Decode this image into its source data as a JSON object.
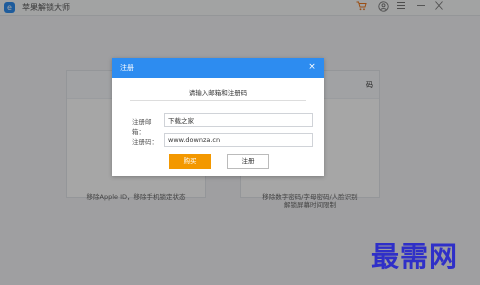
{
  "window": {
    "title": "苹果解锁大师",
    "icons": [
      "app-logo-icon",
      "cart-icon",
      "user-icon",
      "menu-icon",
      "minimize-icon",
      "close-icon"
    ]
  },
  "cards": {
    "left": {
      "desc": "移除Apple ID，移除手机锁定状态"
    },
    "right": {
      "title": "码",
      "desc1": "移除数字密码/字母密码/人脸识别",
      "desc2": "解锁屏幕时间限制"
    }
  },
  "modal": {
    "title": "注册",
    "close": "×",
    "prompt": "请输入邮箱和注册码",
    "email_label": "注册邮箱：",
    "email_value": "下载之家",
    "code_label": "注册码：",
    "code_value": "www.downza.cn",
    "buy_label": "购买",
    "register_label": "注册"
  },
  "watermark": "最需网",
  "colors": {
    "accent": "#2d8cf0",
    "buy": "#f39800",
    "cart": "#ef7a20",
    "watermark": "#2f2fc8"
  }
}
